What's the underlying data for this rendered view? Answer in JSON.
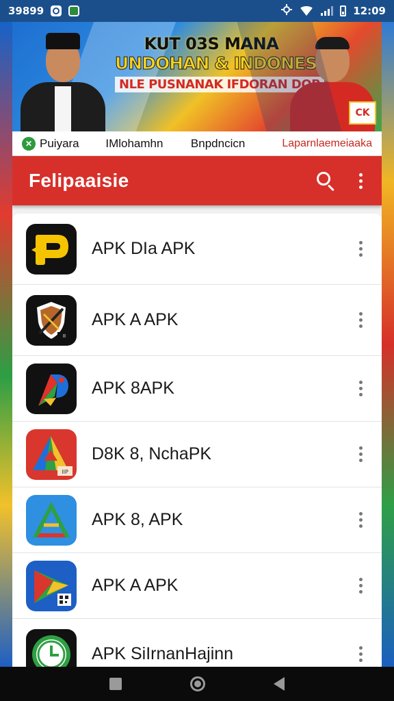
{
  "status_bar": {
    "left_text": "39899",
    "time": "12:09"
  },
  "banner": {
    "line1": "KUT 03S MANA",
    "line2": "UNDOHAN & INDONESIA",
    "line3": "NLE PUSNANAK IFDORAN DOB",
    "badge": "CK"
  },
  "partners": [
    {
      "label": "Puiyara",
      "icon": "x-circle-icon"
    },
    {
      "label": "IMlohamhn"
    },
    {
      "label": "Bnpdncicn"
    },
    {
      "label": "Laparnlaemeiaaka"
    }
  ],
  "app_bar": {
    "title": "Felipaaisie"
  },
  "apps": [
    {
      "label": "APK DIa APK",
      "icon": "yellow-p-logo-icon"
    },
    {
      "label": "APK A APK",
      "icon": "shield-sword-logo-icon"
    },
    {
      "label": "APK 8APK",
      "icon": "colorful-p-logo-icon"
    },
    {
      "label": "D8K 8, NchaPK",
      "icon": "triangle-arrow-logo-icon"
    },
    {
      "label": "APK 8, APK",
      "icon": "blue-a-logo-icon"
    },
    {
      "label": "APK A APK",
      "icon": "play-triangle-logo-icon"
    },
    {
      "label": "APK SiIrnanHajinn",
      "icon": "green-clock-logo-icon"
    }
  ],
  "colors": {
    "app_bar": "#d7302a",
    "status_bar": "#1b4f8c"
  }
}
